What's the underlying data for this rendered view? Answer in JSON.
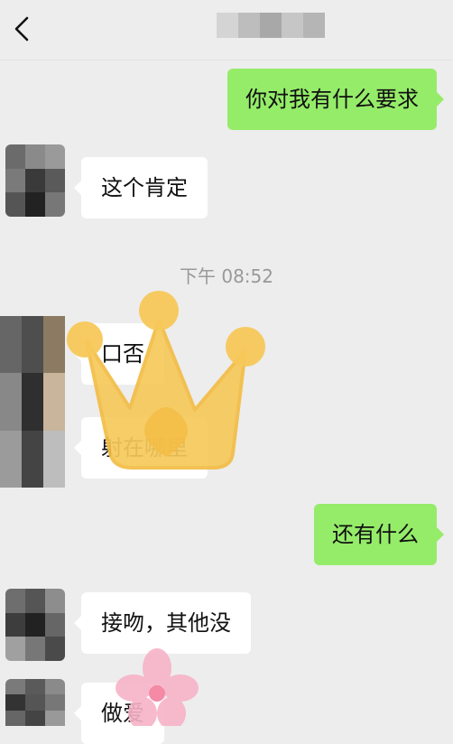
{
  "header": {
    "back_icon": "chevron-left-icon",
    "title_obscured": true
  },
  "messages": [
    {
      "side": "out",
      "text": "你对我有什么要求"
    },
    {
      "side": "in",
      "text": "这个肯定"
    },
    {
      "side": "in",
      "text": "口否"
    },
    {
      "side": "in",
      "text": "射在哪里"
    },
    {
      "side": "out",
      "text": "还有什么"
    },
    {
      "side": "in",
      "text": "接吻，其他没"
    },
    {
      "side": "in",
      "text": "做爱"
    }
  ],
  "timestamp": "下午 08:52",
  "stickers": [
    "crown-sticker",
    "flower-sticker"
  ],
  "colors": {
    "outgoing_bubble": "#95ec69",
    "incoming_bubble": "#ffffff",
    "background": "#ededed"
  }
}
